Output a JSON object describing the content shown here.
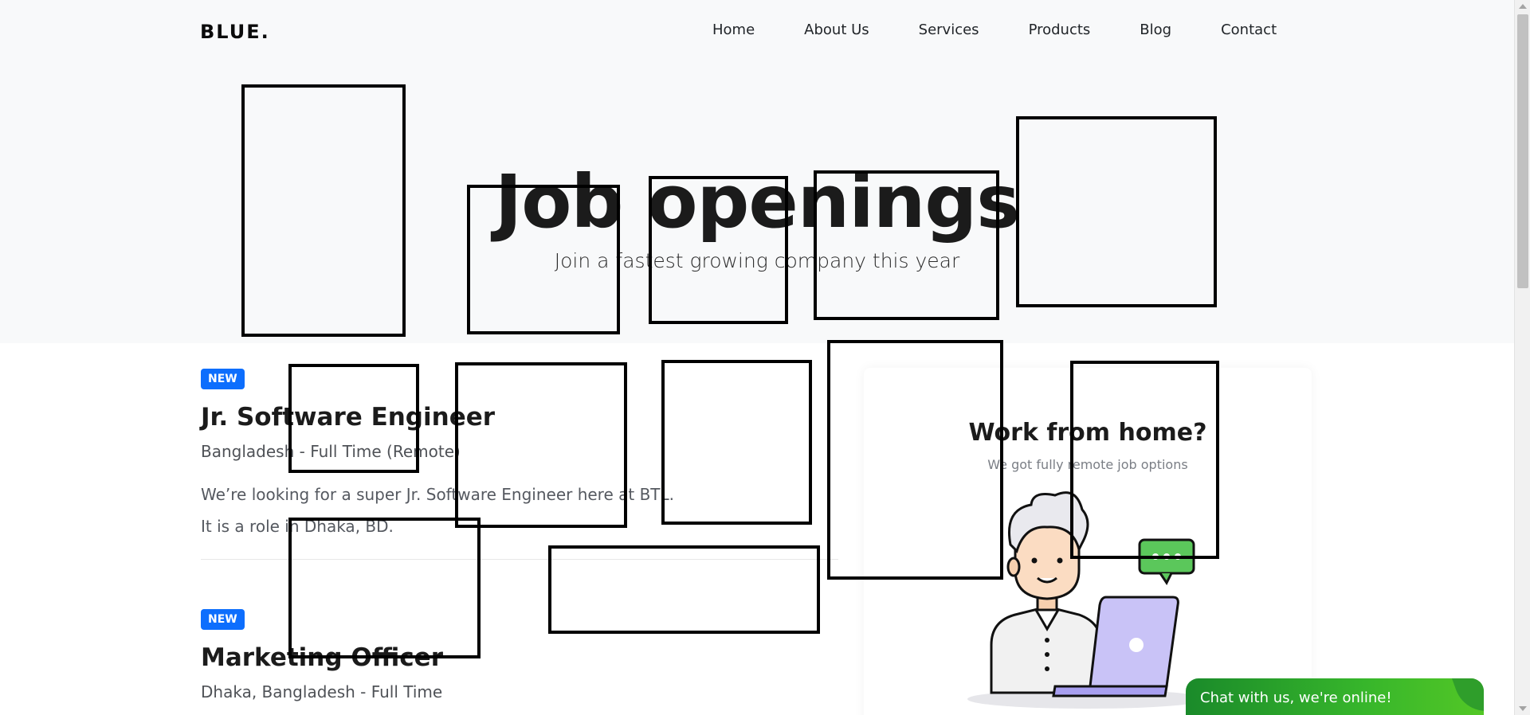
{
  "brand": {
    "logo_text": "BLUE."
  },
  "nav": {
    "items": [
      {
        "label": "Home"
      },
      {
        "label": "About Us"
      },
      {
        "label": "Services"
      },
      {
        "label": "Products"
      },
      {
        "label": "Blog"
      },
      {
        "label": "Contact"
      }
    ]
  },
  "hero": {
    "title": "Job openings",
    "subtitle": "Join a fastest growing company this year"
  },
  "jobs": [
    {
      "badge": "NEW",
      "title": "Jr. Software Engineer",
      "meta": "Bangladesh - Full Time (Remote)",
      "desc_line1": "We’re looking for a super Jr. Software Engineer here at BTL.",
      "desc_line2": "It is a role in Dhaka, BD."
    },
    {
      "badge": "NEW",
      "title": "Marketing Officer",
      "meta": "Dhaka, Bangladesh - Full Time"
    }
  ],
  "card": {
    "title": "Work from home?",
    "subtitle": "We got fully remote job options"
  },
  "chat": {
    "label": "Chat with us, we're online!"
  },
  "colors": {
    "accent": "#0d6efd",
    "hero_bg": "#f8f9fa",
    "chat_green": "#37b62b"
  }
}
